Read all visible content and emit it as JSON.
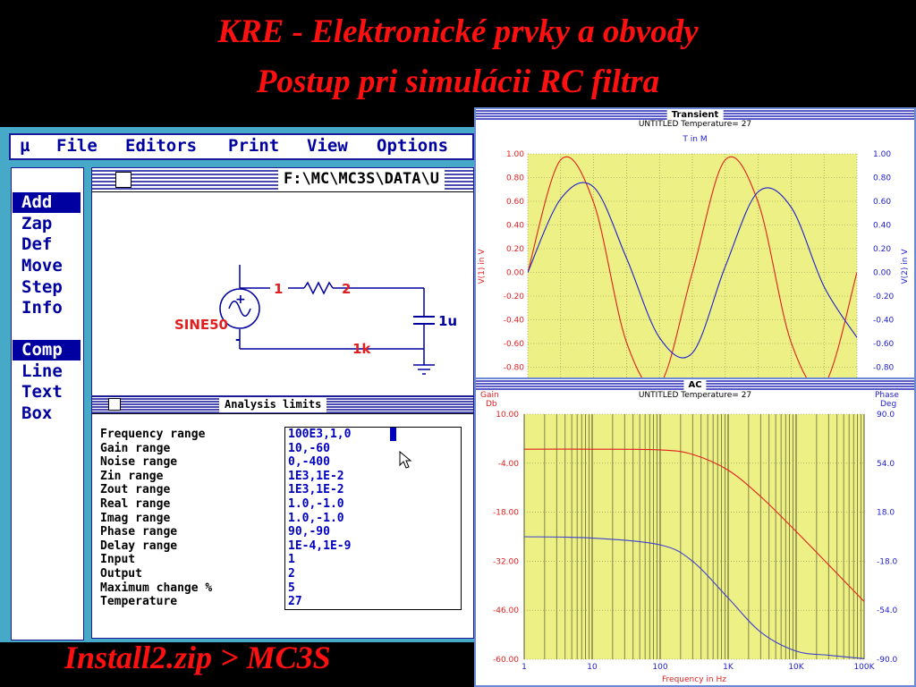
{
  "slide": {
    "title_line1": "KRE - Elektronické  prvky a obvody",
    "title_line2": "Postup pri simulácii RC filtra",
    "footer": "Install2.zip > MC3S"
  },
  "menu": [
    {
      "label": "µ"
    },
    {
      "label": "File"
    },
    {
      "label": "Editors"
    },
    {
      "label": "Print"
    },
    {
      "label": "View"
    },
    {
      "label": "Options"
    }
  ],
  "tools": [
    {
      "label": "Add",
      "selected": true
    },
    {
      "label": "Zap"
    },
    {
      "label": "Def"
    },
    {
      "label": "Move"
    },
    {
      "label": "Step"
    },
    {
      "label": "Info"
    },
    {
      "label": "Comp",
      "selected": true
    },
    {
      "label": "Line"
    },
    {
      "label": "Text"
    },
    {
      "label": "Box"
    }
  ],
  "schematic": {
    "path": "F:\\MC\\MC3S\\DATA\\U",
    "source_label": "SINE50",
    "node1": "1",
    "node2": "2",
    "cap_label": "1u",
    "res_label": "1k",
    "plus": "+",
    "minus": "-"
  },
  "analysis": {
    "title": "Analysis limits",
    "rows": [
      {
        "label": "Frequency range",
        "value": "100E3,1,0"
      },
      {
        "label": "Gain range",
        "value": "10,-60"
      },
      {
        "label": "Noise range",
        "value": "0,-400"
      },
      {
        "label": "Zin range",
        "value": "1E3,1E-2"
      },
      {
        "label": "Zout range",
        "value": "1E3,1E-2"
      },
      {
        "label": "Real range",
        "value": "1.0,-1.0"
      },
      {
        "label": "Imag range",
        "value": "1.0,-1.0"
      },
      {
        "label": "Phase range",
        "value": "90,-90"
      },
      {
        "label": "Delay range",
        "value": "1E-4,1E-9"
      },
      {
        "label": "Input",
        "value": "1"
      },
      {
        "label": "Output",
        "value": "2"
      },
      {
        "label": "Maximum change %",
        "value": "5"
      },
      {
        "label": "Temperature",
        "value": "27"
      }
    ]
  },
  "transient": {
    "window_title": "Transient",
    "header": "UNTITLED Temperature= 27",
    "xlabel": "T in M",
    "ylabel_left": "V(1) in V",
    "ylabel_right": "V(2) in V",
    "yticks": [
      "1.00",
      "0.80",
      "0.60",
      "0.40",
      "0.20",
      "0.00",
      "-0.20",
      "-0.40",
      "-0.60",
      "-0.80"
    ],
    "plot_bg": "#ecf085"
  },
  "ac": {
    "window_title": "AC",
    "header": "UNTITLED Temperature= 27",
    "left_title_1": "Gain",
    "left_title_2": "Db",
    "right_title_1": "Phase",
    "right_title_2": "Deg",
    "xlabel": "Frequency in Hz",
    "left_ticks": [
      "10.00",
      "-4.00",
      "-18.00",
      "-32.00",
      "-46.00",
      "-60.00"
    ],
    "right_ticks": [
      "90.0",
      "54.0",
      "18.0",
      "-18.0",
      "-54.0",
      "-90.0"
    ],
    "xticks": [
      "1",
      "10",
      "100",
      "1K",
      "10K",
      "100K"
    ],
    "plot_bg": "#ecf085"
  },
  "chart_data": [
    {
      "type": "line",
      "title": "Transient",
      "xlabel": "T in M",
      "ylabel": "V(1) in V",
      "ylim": [
        -0.8,
        1.0
      ],
      "grid": true,
      "x": [
        0,
        1,
        2,
        3,
        4,
        5,
        6,
        7,
        8,
        9,
        10
      ],
      "series": [
        {
          "values": [
            0.0,
            0.95,
            0.59,
            -0.59,
            -0.95,
            0.0,
            0.95,
            0.59,
            -0.59,
            -0.95,
            0.0
          ],
          "color": "#e02020"
        },
        {
          "values": [
            0.0,
            0.62,
            0.72,
            0.12,
            -0.55,
            -0.68,
            0.05,
            0.68,
            0.55,
            -0.12,
            -0.55
          ],
          "color": "#2020d0"
        }
      ]
    },
    {
      "type": "line",
      "title": "AC",
      "xlabel": "Frequency in Hz",
      "ylabel": "Gain Db",
      "xscale": "log",
      "xlim": [
        1,
        100000
      ],
      "ylim": [
        -60,
        10
      ],
      "grid": true,
      "x": [
        1,
        10,
        100,
        300,
        1000,
        3000,
        10000,
        30000,
        100000
      ],
      "series": [
        {
          "axis": "left",
          "values": [
            0.0,
            0.0,
            -0.2,
            -1.5,
            -6.0,
            -13.5,
            -23.5,
            -33.0,
            -43.5
          ],
          "color": "#e02020"
        },
        {
          "axis": "right",
          "values": [
            0.0,
            -1.0,
            -6.0,
            -18.0,
            -45.0,
            -70.0,
            -84.0,
            -87.0,
            -89.5
          ],
          "color": "#4040d0"
        }
      ]
    }
  ]
}
